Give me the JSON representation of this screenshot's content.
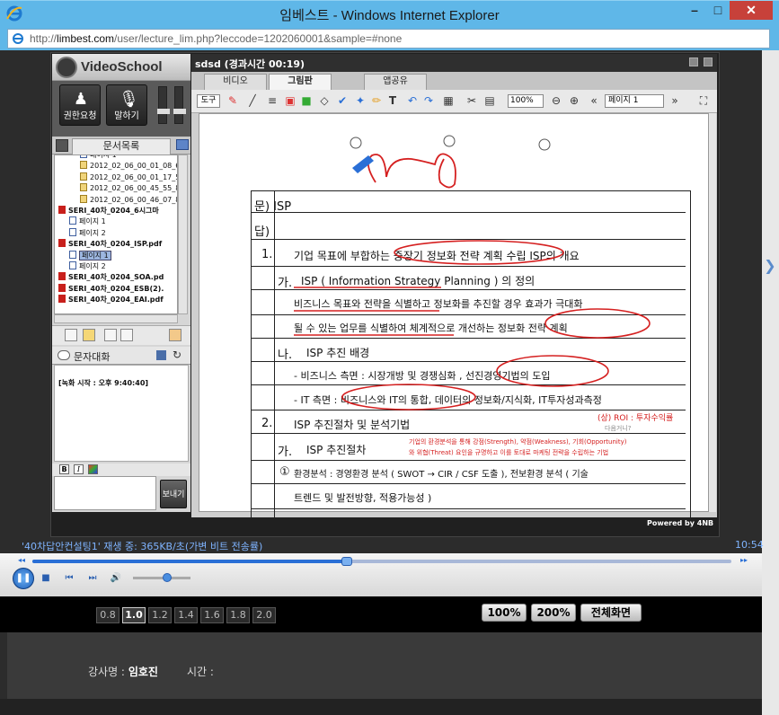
{
  "window": {
    "title": "임베스트 - Windows Internet Explorer",
    "min": "–",
    "max": "□",
    "close": "✕"
  },
  "address": {
    "prefix": "http://",
    "host": "limbest.com",
    "path": "/user/lecture_lim.php?leccode=1202060001&sample=#none"
  },
  "app": {
    "brand": "VideoSchool",
    "session_title": "sdsd (경과시간 00:19)"
  },
  "controls": {
    "permission": "권한요청",
    "speak": "말하기"
  },
  "docs": {
    "tab_label": "문서목록",
    "items": [
      {
        "label": "페이지 1",
        "level": 2,
        "type": "page"
      },
      {
        "label": "2012_02_06_00_01_08_6",
        "level": 2,
        "type": "note"
      },
      {
        "label": "2012_02_06_00_01_17_5",
        "level": 2,
        "type": "note"
      },
      {
        "label": "2012_02_06_00_45_55_8",
        "level": 2,
        "type": "note"
      },
      {
        "label": "2012_02_06_00_46_07_8",
        "level": 2,
        "type": "note"
      },
      {
        "label": "SERI_40차_0204_6시그마",
        "level": 0,
        "type": "pdf"
      },
      {
        "label": "페이지 1",
        "level": 1,
        "type": "page"
      },
      {
        "label": "페이지 2",
        "level": 1,
        "type": "page"
      },
      {
        "label": "SERI_40차_0204_ISP.pdf",
        "level": 0,
        "type": "pdf"
      },
      {
        "label": "페이지 1",
        "level": 1,
        "type": "page",
        "selected": true
      },
      {
        "label": "페이지 2",
        "level": 1,
        "type": "page"
      },
      {
        "label": "SERI_40차_0204_SOA.pd",
        "level": 0,
        "type": "pdf"
      },
      {
        "label": "SERI_40차_0204_ESB(2).",
        "level": 0,
        "type": "pdf"
      },
      {
        "label": "SERI_40차_0204_EAI.pdf",
        "level": 0,
        "type": "pdf"
      }
    ]
  },
  "chat": {
    "title": "문자대화",
    "log": "[녹화 시작 : 오후 9:40:40]",
    "send": "보내기",
    "bold": "B",
    "italic": "I"
  },
  "tabs": [
    {
      "label": "비디오"
    },
    {
      "label": "그림판",
      "active": true
    },
    {
      "label": "앱공유"
    }
  ],
  "toolbar": {
    "tool": "도구",
    "zoom": "100%",
    "page": "페이지 1"
  },
  "sheet": {
    "q": "문) ISP",
    "a": "답)",
    "l1_num": "1.",
    "l1": "기업 목표에 부합하는 중장기 정보화 전략 계획 수립 ISP의 개요",
    "l2_num": "가.",
    "l2": "ISP ( Information Strategy Planning ) 의 정의",
    "l3": "비즈니스 목표와 전략을 식별하고 정보화를 추진할 경우 효과가 극대화",
    "l4": "될 수 있는 업무를 식별하여 체계적으로 개선하는 정보화 전략 계획",
    "l5_num": "나.",
    "l5": "ISP 추진 배경",
    "l6": "- 비즈니스 측면 : 시장개방 및 경쟁심화 , 선진경영기법의 도입",
    "l7": "- IT 측면 : 비즈니스와 IT의 통합, 데이터의 정보화/지식화, IT투자성과측정",
    "l7_note": "(상) ROI : 투자수익률",
    "l7_note2": "다음거니?",
    "l8_num": "2.",
    "l8": "ISP 추진절차 및 분석기법",
    "l9_num": "가.",
    "l9": "ISP 추진절차",
    "l9_note1": "기업의 환경분석을 통해 강점(Strength), 약점(Weakness), 기회(Opportunity)",
    "l9_note2": "와 위협(Threat) 요인을 규명하고 이를 토대로 마케팅 전략을 수립하는 기법",
    "l10_num": "①",
    "l10": "환경분석 : 경영환경 분석 ( SWOT → CIR / CSF 도출 ), 전보환경 분석 ( 기술",
    "l11": "트렌드 및 발전방향, 적용가능성 )"
  },
  "player": {
    "status": "'40차답안컨설팅1' 재생 중: 365KB/초(가변 비트 전송률)",
    "time": "10:54",
    "progress": 0.45,
    "volume": 0.6,
    "powered": "Powered by 4NB",
    "speeds": [
      "0.8",
      "1.0",
      "1.2",
      "1.4",
      "1.6",
      "1.8",
      "2.0"
    ],
    "active_speed": "1.0",
    "zoom100": "100%",
    "zoom200": "200%",
    "fullscreen": "전체화면"
  },
  "lecturer": {
    "label": "강사명 :",
    "name": "임호진",
    "time_label": "시간 :"
  },
  "colors": {
    "accent": "#2a6fd6",
    "ink_red": "#d52020",
    "chrome": "#5fb7e8"
  }
}
